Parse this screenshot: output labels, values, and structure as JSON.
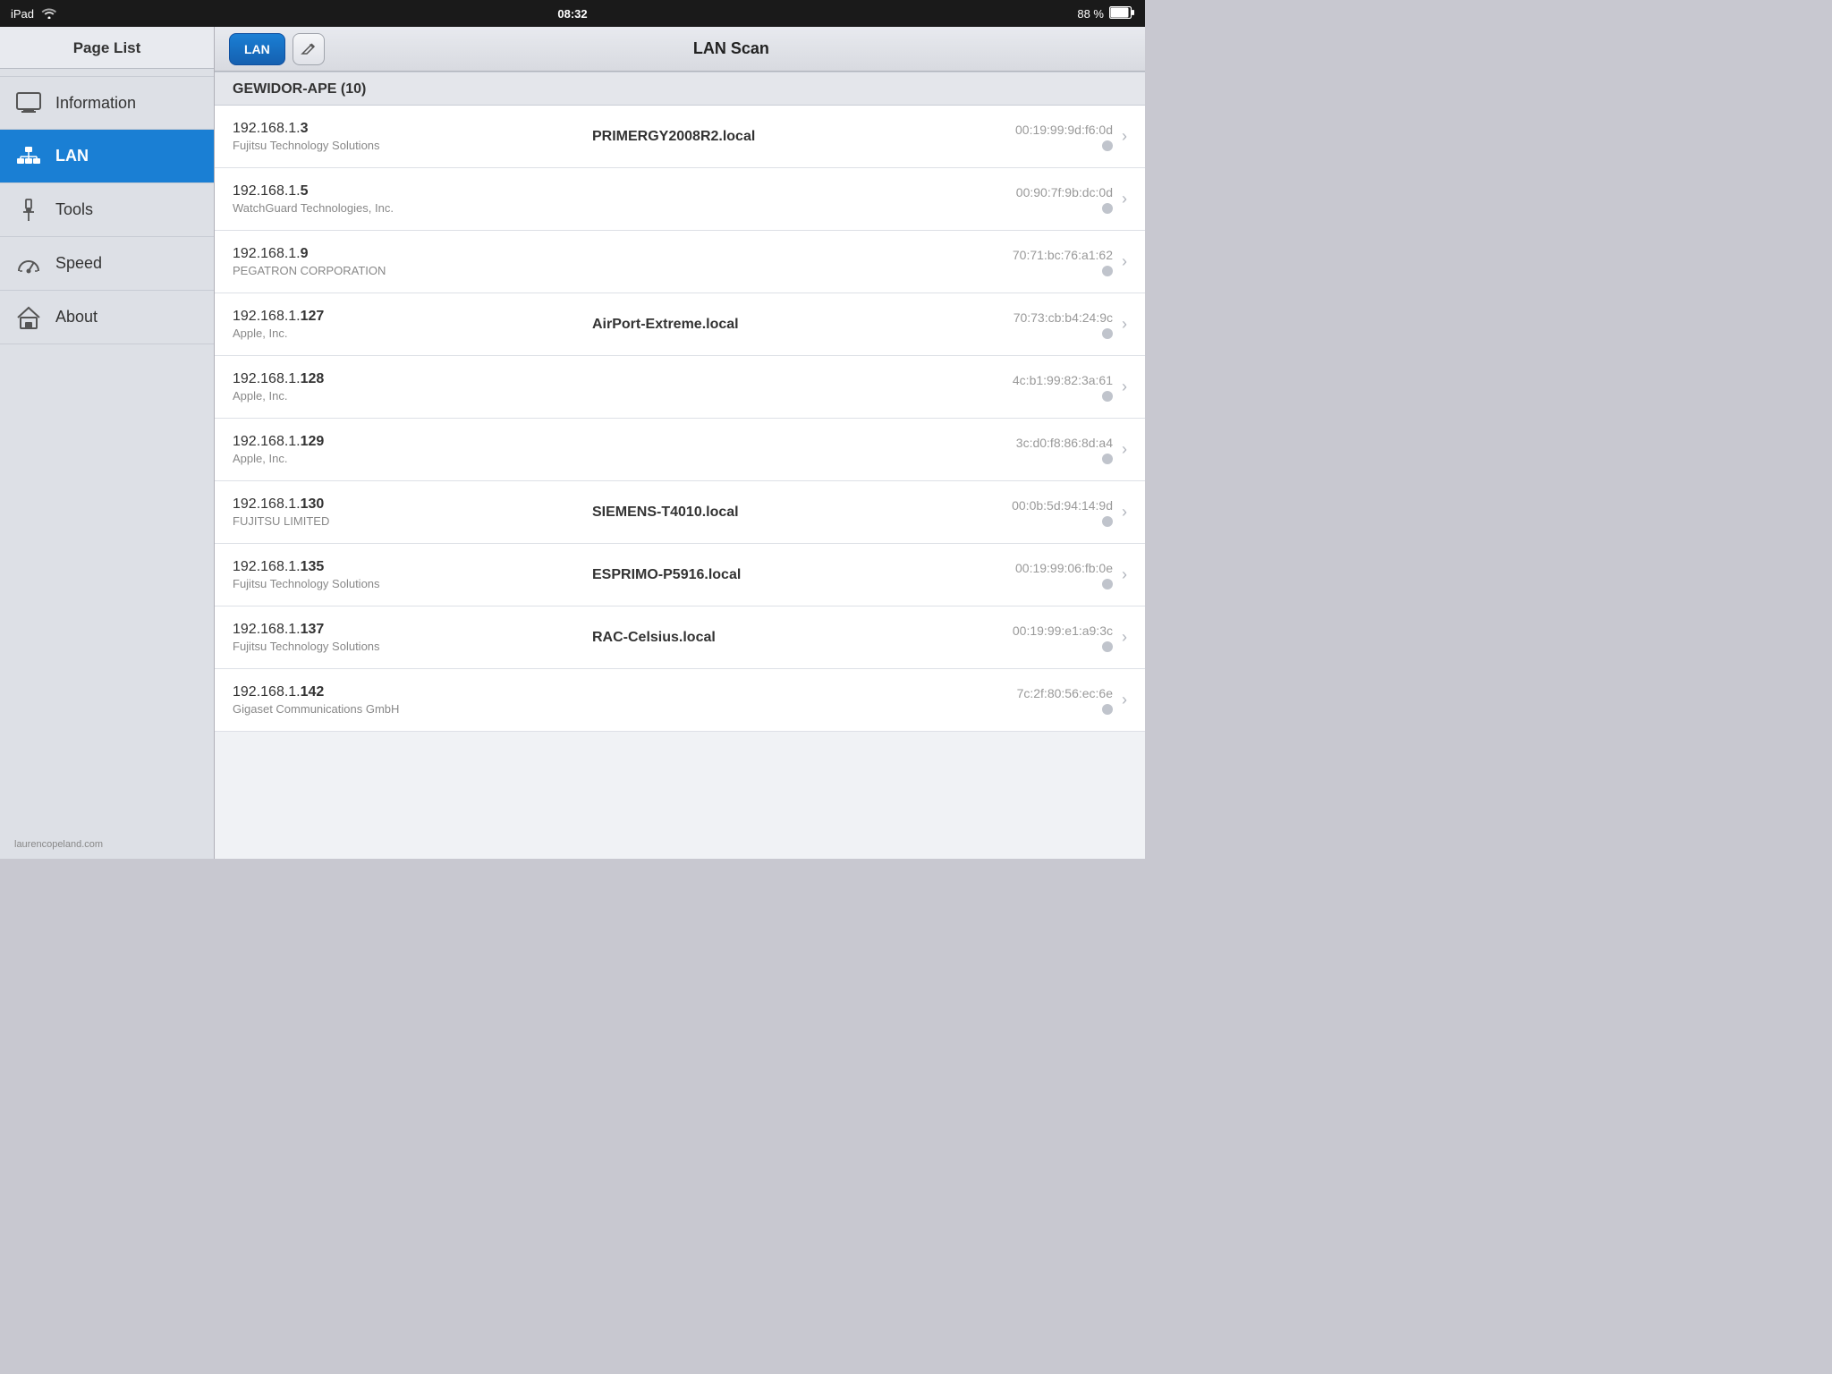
{
  "statusBar": {
    "left": "iPad",
    "wifi": "wifi",
    "time": "08:32",
    "battery": "88 %"
  },
  "sidebar": {
    "title": "Page List",
    "items": [
      {
        "id": "information",
        "label": "Information",
        "icon": "monitor-icon",
        "active": false
      },
      {
        "id": "lan",
        "label": "LAN",
        "icon": "lan-icon",
        "active": true
      },
      {
        "id": "tools",
        "label": "Tools",
        "icon": "tools-icon",
        "active": false
      },
      {
        "id": "speed",
        "label": "Speed",
        "icon": "speed-icon",
        "active": false
      },
      {
        "id": "about",
        "label": "About",
        "icon": "house-icon",
        "active": false
      }
    ],
    "footer": "laurencopeland.com"
  },
  "toolbar": {
    "lanButton": "LAN",
    "title": "LAN Scan"
  },
  "deviceList": {
    "sectionHeader": "GEWIDOR-APE (10)",
    "devices": [
      {
        "ipBase": "192.168.1.",
        "ipEnd": "3",
        "vendor": "Fujitsu Technology Solutions",
        "hostname": "PRIMERGY2008R2.local",
        "mac": "00:19:99:9d:f6:0d"
      },
      {
        "ipBase": "192.168.1.",
        "ipEnd": "5",
        "vendor": "WatchGuard Technologies, Inc.",
        "hostname": "",
        "mac": "00:90:7f:9b:dc:0d"
      },
      {
        "ipBase": "192.168.1.",
        "ipEnd": "9",
        "vendor": "PEGATRON CORPORATION",
        "hostname": "",
        "mac": "70:71:bc:76:a1:62"
      },
      {
        "ipBase": "192.168.1.",
        "ipEnd": "127",
        "vendor": "Apple, Inc.",
        "hostname": "AirPort-Extreme.local",
        "mac": "70:73:cb:b4:24:9c"
      },
      {
        "ipBase": "192.168.1.",
        "ipEnd": "128",
        "vendor": "Apple, Inc.",
        "hostname": "",
        "mac": "4c:b1:99:82:3a:61"
      },
      {
        "ipBase": "192.168.1.",
        "ipEnd": "129",
        "vendor": "Apple, Inc.",
        "hostname": "",
        "mac": "3c:d0:f8:86:8d:a4"
      },
      {
        "ipBase": "192.168.1.",
        "ipEnd": "130",
        "vendor": "FUJITSU LIMITED",
        "hostname": "SIEMENS-T4010.local",
        "mac": "00:0b:5d:94:14:9d"
      },
      {
        "ipBase": "192.168.1.",
        "ipEnd": "135",
        "vendor": "Fujitsu Technology Solutions",
        "hostname": "ESPRIMO-P5916.local",
        "mac": "00:19:99:06:fb:0e"
      },
      {
        "ipBase": "192.168.1.",
        "ipEnd": "137",
        "vendor": "Fujitsu Technology Solutions",
        "hostname": "RAC-Celsius.local",
        "mac": "00:19:99:e1:a9:3c"
      },
      {
        "ipBase": "192.168.1.",
        "ipEnd": "142",
        "vendor": "Gigaset Communications GmbH",
        "hostname": "",
        "mac": "7c:2f:80:56:ec:6e"
      }
    ]
  }
}
